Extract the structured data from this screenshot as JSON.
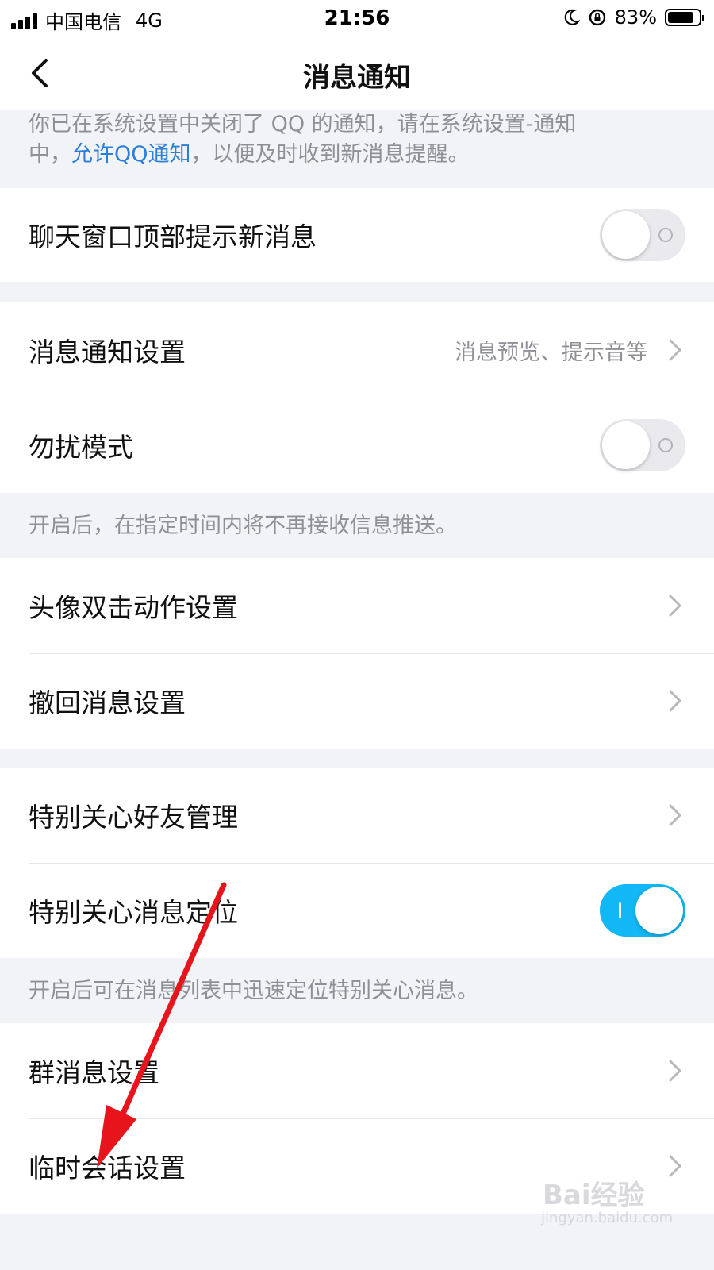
{
  "status_bar": {
    "carrier": "中国电信",
    "network": "4G",
    "time": "21:56",
    "battery": "83%",
    "battery_level": 0.83
  },
  "nav": {
    "title": "消息通知"
  },
  "notice": {
    "line1": "你已在系统设置中关闭了 QQ 的通知，请在系统设置-通知",
    "line2_prefix": "中，",
    "link": "允许QQ通知",
    "line2_suffix": "，以便及时收到新消息提醒。"
  },
  "rows": {
    "chat_top_alert": {
      "label": "聊天窗口顶部提示新消息",
      "toggle_on": false
    },
    "message_notification_settings": {
      "label": "消息通知设置",
      "value": "消息预览、提示音等"
    },
    "do_not_disturb": {
      "label": "勿扰模式",
      "toggle_on": false
    },
    "dnd_hint": "开启后，在指定时间内将不再接收信息推送。",
    "avatar_double_tap": {
      "label": "头像双击动作设置"
    },
    "recall_message": {
      "label": "撤回消息设置"
    },
    "special_care_friends": {
      "label": "特别关心好友管理"
    },
    "special_care_locate": {
      "label": "特别关心消息定位",
      "toggle_on": true
    },
    "special_care_hint": "开启后可在消息列表中迅速定位特别关心消息。",
    "group_message": {
      "label": "群消息设置"
    },
    "temp_session": {
      "label": "临时会话设置"
    }
  },
  "watermark": {
    "brand": "Bai经验",
    "url": "jingyan.baidu.com"
  },
  "colors": {
    "accent": "#12b7f5",
    "link": "#2a7fdb",
    "background": "#f2f3f7",
    "arrow": "#e8141c"
  }
}
